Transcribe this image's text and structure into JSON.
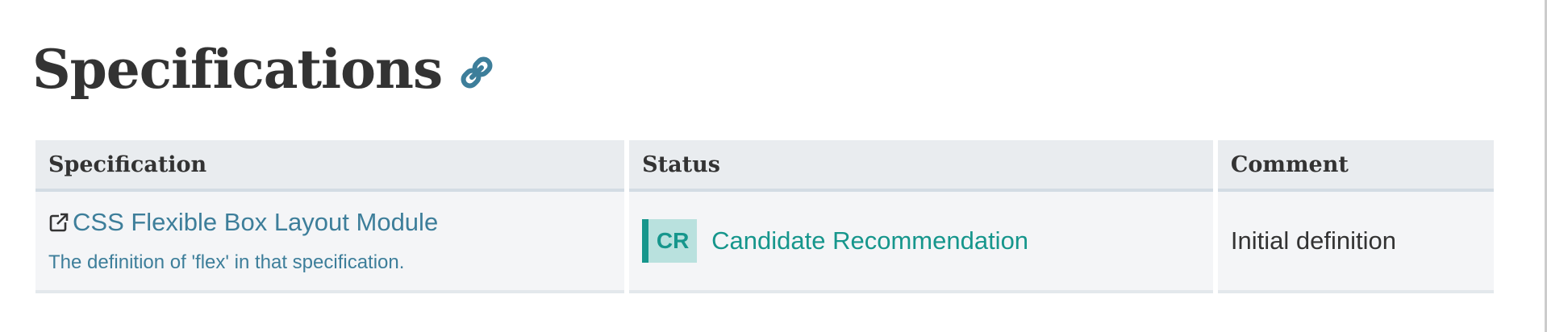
{
  "heading": {
    "title": "Specifications",
    "anchor_icon": "link-icon"
  },
  "table": {
    "headers": [
      "Specification",
      "Status",
      "Comment"
    ],
    "rows": [
      {
        "spec_name": "CSS Flexible Box Layout Module",
        "spec_icon": "external-link-icon",
        "spec_desc": "The definition of 'flex' in that specification.",
        "status_badge": "CR",
        "status_text": "Candidate Recommendation",
        "comment": "Initial definition"
      }
    ]
  },
  "colors": {
    "link": "#3d7e9a",
    "status": "#16968c",
    "status_badge_bg": "#b9e1de",
    "header_bg": "#e9ecef",
    "row_bg": "#f4f5f7"
  }
}
